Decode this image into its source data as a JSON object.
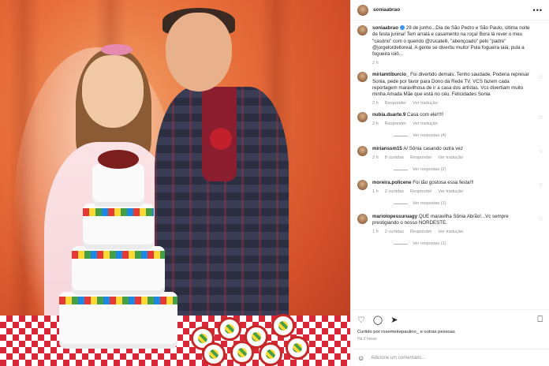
{
  "post": {
    "username": "soniaabrao",
    "caption": "29 de junho...Dia de São Pedro e São Paulo, última noite de festa junina! Tem arraiá e casamento na roça! Bora lá rever o meu \"casório\" com o querido @zucatelli, \"abençoado\" pelo \"padre\" @jorgelordelloreal. A gente se divertiu muito! Pula fogueira iaiá, pula a fogueira ioiô...",
    "caption_age": "2 h"
  },
  "comments": [
    {
      "username": "miriamtiburcio_",
      "text": "Foi divertido demais. Tenho saudade. Poderia represar Sonia, pede por favor para Dono da Rede TV. VCS fazem cada reportagem maravilhosa de ir a casa dos artistas. Vcs divertiam muito minha Amada Mãe que está no céu. Felicidades Sonia",
      "age": "2 h",
      "reply_label": "Responder",
      "translate_label": "Ver tradução",
      "likes": ""
    },
    {
      "username": "nubia.duarte.9",
      "text": "Casa com ele!!!!!",
      "age": "2 h",
      "reply_label": "Responder",
      "translate_label": "Ver tradução",
      "likes": "",
      "replies": "Ver respostas (4)"
    },
    {
      "username": "mirianssm15",
      "text": "A/ Sônia casando outra vez",
      "age": "2 h",
      "reply_label": "Responder",
      "translate_label": "Ver tradução",
      "likes": "8 curtidas",
      "replies": "Ver respostas (2)"
    },
    {
      "username": "moreira.policene",
      "text": "Foi tão gostosa essa festa!!!",
      "age": "1 h",
      "reply_label": "Responder",
      "translate_label": "Ver tradução",
      "likes": "2 curtidas",
      "replies": "Ver respostas (1)"
    },
    {
      "username": "mariolopessuruagy",
      "text": "QUE maravilha Sônia Abrão!...Vc sempre prestigiando o nosso NORDESTE.",
      "age": "1 h",
      "reply_label": "Responder",
      "translate_label": "Ver tradução",
      "likes": "2 curtidas",
      "replies": "Ver respostas (1)"
    }
  ],
  "footer": {
    "liked_by": "Curtido por rosemeirepaulino_ e outras pessoas",
    "time": "Há 2 horas",
    "add_comment_placeholder": "Adicione um comentário..."
  },
  "icons": {
    "like": "heart-icon",
    "comment": "comment-icon",
    "share": "share-icon",
    "save": "bookmark-icon",
    "emoji": "emoji-icon",
    "more": "more-icon"
  }
}
